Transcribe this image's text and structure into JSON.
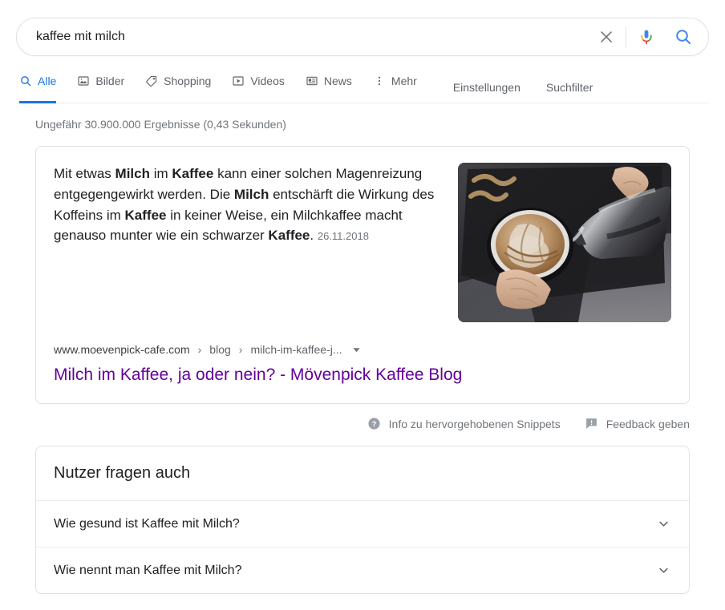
{
  "search": {
    "query": "kaffee mit milch",
    "placeholder": "",
    "clear_icon": "close-icon",
    "mic_icon": "microphone-icon",
    "submit_icon": "search-icon"
  },
  "nav": {
    "tabs": [
      {
        "label": "Alle",
        "icon": "search-icon",
        "active": true
      },
      {
        "label": "Bilder",
        "icon": "image-icon",
        "active": false
      },
      {
        "label": "Shopping",
        "icon": "tag-icon",
        "active": false
      },
      {
        "label": "Videos",
        "icon": "video-icon",
        "active": false
      },
      {
        "label": "News",
        "icon": "newspaper-icon",
        "active": false
      },
      {
        "label": "Mehr",
        "icon": "more-vertical-icon",
        "active": false
      }
    ],
    "links": [
      {
        "label": "Einstellungen"
      },
      {
        "label": "Suchfilter"
      }
    ]
  },
  "stats": {
    "text": "Ungefähr 30.900.000 Ergebnisse (0,43 Sekunden)"
  },
  "featured_snippet": {
    "snippet_parts": [
      {
        "text": "Mit etwas ",
        "bold": false
      },
      {
        "text": "Milch",
        "bold": true
      },
      {
        "text": " im ",
        "bold": false
      },
      {
        "text": "Kaffee",
        "bold": true
      },
      {
        "text": " kann einer solchen Magenreizung entgegengewirkt werden. Die ",
        "bold": false
      },
      {
        "text": "Milch",
        "bold": true
      },
      {
        "text": " entschärft die Wirkung des Koffeins im ",
        "bold": false
      },
      {
        "text": "Kaffee",
        "bold": true
      },
      {
        "text": " in keiner Weise, ein Milchkaffee macht genauso munter wie ein schwarzer ",
        "bold": false
      },
      {
        "text": "Kaffee",
        "bold": true
      },
      {
        "text": ". ",
        "bold": false
      }
    ],
    "date": "26.11.2018",
    "thumbnail_alt": "barista-pouring-latte-art",
    "breadcrumb": {
      "host": "www.moevenpick-cafe.com",
      "sep1": "›",
      "part1": "blog",
      "sep2": "›",
      "part2": "milch-im-kaffee-j...",
      "arrow_icon": "caret-down-icon"
    },
    "title": "Milch im Kaffee, ja oder nein? - Mövenpick Kaffee Blog"
  },
  "feedback": {
    "info_icon": "question-circle-icon",
    "info_label": "Info zu hervorgehobenen Snippets",
    "flag_icon": "feedback-flag-icon",
    "flag_label": "Feedback geben"
  },
  "people_also_ask": {
    "heading": "Nutzer fragen auch",
    "items": [
      {
        "question": "Wie gesund ist Kaffee mit Milch?",
        "icon": "chevron-down-icon"
      },
      {
        "question": "Wie nennt man Kaffee mit Milch?",
        "icon": "chevron-down-icon"
      }
    ]
  },
  "colors": {
    "accent_blue": "#1a73e8",
    "link_purple": "#660099",
    "text_primary": "#202124",
    "text_secondary": "#5f6368",
    "text_muted": "#70757a",
    "border": "#dfe1e5",
    "google_red": "#ea4335",
    "google_yellow": "#fbbc05",
    "google_green": "#34a853"
  }
}
